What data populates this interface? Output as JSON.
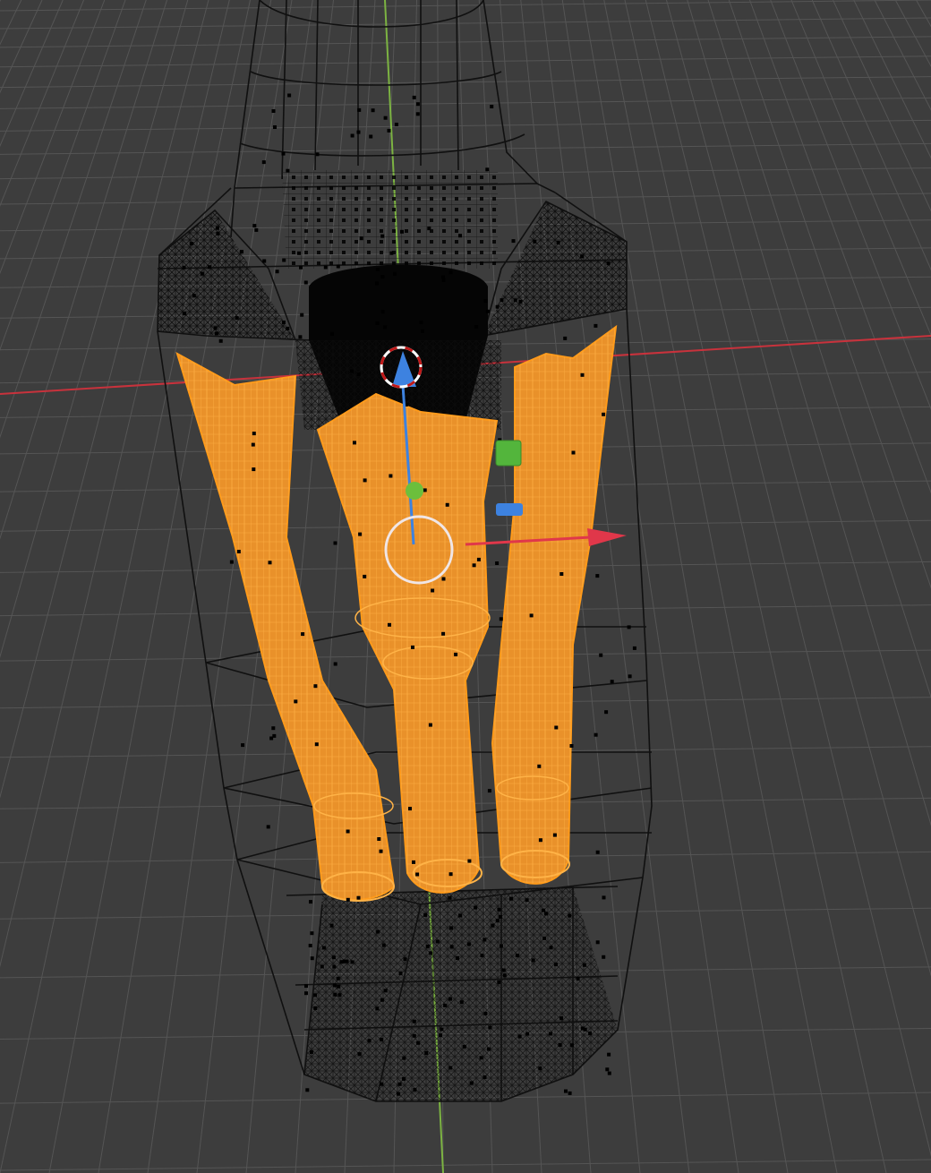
{
  "viewport": {
    "mode": "wireframe",
    "background_color": "#3d3d3d",
    "grid_color": "#555555",
    "x_axis_color": "#c8323c",
    "y_axis_color": "#7cb342",
    "wire_color": "#101010",
    "selected_wire_color": "#ff9a1a",
    "selected_fill_color": "#f39a2a",
    "vertex_color": "#000000"
  },
  "objects": [
    {
      "name": "outer-shell-mesh",
      "selected": false
    },
    {
      "name": "inner-cavity-mesh",
      "selected": false
    },
    {
      "name": "left-tube-mesh",
      "selected": true
    },
    {
      "name": "center-tube-mesh",
      "selected": true
    },
    {
      "name": "right-tube-mesh",
      "selected": true
    }
  ],
  "gizmo": {
    "type": "move",
    "x_axis_color": "#e0374a",
    "y_axis_color": "#6cbf3c",
    "z_axis_color": "#3d82e0",
    "z_plane_handle_color": "#3d82e0",
    "y_plane_handle_color": "#53b53c",
    "center_ring_color": "#f0e6e6",
    "cursor_ring_colors": [
      "#c01818",
      "#ffffff"
    ]
  }
}
